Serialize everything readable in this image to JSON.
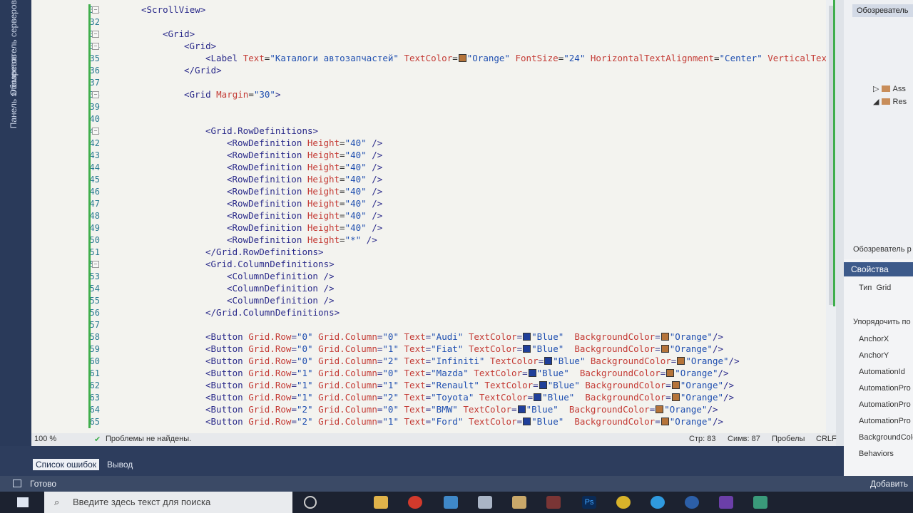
{
  "left_strip": {
    "item1": "Обозреватель серверов",
    "item2": "Панель элементов"
  },
  "lines": [
    {
      "n": "31",
      "html": "<span class=\"t\">&lt;ScrollView&gt;</span>",
      "indent": 1
    },
    {
      "n": "32",
      "html": "",
      "indent": 0
    },
    {
      "n": "33",
      "html": "<span class=\"t\">&lt;Grid&gt;</span>",
      "indent": 2
    },
    {
      "n": "34",
      "html": "<span class=\"t\">&lt;Grid&gt;</span>",
      "indent": 3
    },
    {
      "n": "35",
      "html": "<span class=\"t\">&lt;Label </span><span class=\"a\">Text</span><span class=\"p\">=</span><span class=\"v\">\"Каталоги автозапчастей\"</span> <span class=\"a\">TextColor</span><span class=\"p\">=</span>[SW:orange]<span class=\"v\">\"Orange\"</span> <span class=\"a\">FontSize</span><span class=\"p\">=</span><span class=\"v\">\"24\"</span> <span class=\"a\">HorizontalTextAlignment</span><span class=\"p\">=</span><span class=\"v\">\"Center\"</span> <span class=\"a\">VerticalTextAlignme</span>",
      "indent": 4
    },
    {
      "n": "36",
      "html": "<span class=\"t\">&lt;/Grid&gt;</span>",
      "indent": 3
    },
    {
      "n": "37",
      "html": "",
      "indent": 0
    },
    {
      "n": "38",
      "html": "<span class=\"t\">&lt;Grid </span><span class=\"a\">Margin</span><span class=\"p\">=</span><span class=\"v\">\"30\"</span><span class=\"t\">&gt;</span>",
      "indent": 3
    },
    {
      "n": "39",
      "html": "",
      "indent": 0
    },
    {
      "n": "40",
      "html": "",
      "indent": 0
    },
    {
      "n": "41",
      "html": "<span class=\"t\">&lt;Grid.RowDefinitions&gt;</span>",
      "indent": 4
    },
    {
      "n": "42",
      "html": "<span class=\"t\">&lt;RowDefinition </span><span class=\"a\">Height</span><span class=\"p\">=</span><span class=\"v\">\"40\"</span><span class=\"t\"> /&gt;</span>",
      "indent": 5
    },
    {
      "n": "43",
      "html": "<span class=\"t\">&lt;RowDefinition </span><span class=\"a\">Height</span><span class=\"p\">=</span><span class=\"v\">\"40\"</span><span class=\"t\"> /&gt;</span>",
      "indent": 5
    },
    {
      "n": "44",
      "html": "<span class=\"t\">&lt;RowDefinition </span><span class=\"a\">Height</span><span class=\"p\">=</span><span class=\"v\">\"40\"</span><span class=\"t\"> /&gt;</span>",
      "indent": 5
    },
    {
      "n": "45",
      "html": "<span class=\"t\">&lt;RowDefinition </span><span class=\"a\">Height</span><span class=\"p\">=</span><span class=\"v\">\"40\"</span><span class=\"t\"> /&gt;</span>",
      "indent": 5
    },
    {
      "n": "46",
      "html": "<span class=\"t\">&lt;RowDefinition </span><span class=\"a\">Height</span><span class=\"p\">=</span><span class=\"v\">\"40\"</span><span class=\"t\"> /&gt;</span>",
      "indent": 5
    },
    {
      "n": "47",
      "html": "<span class=\"t\">&lt;RowDefinition </span><span class=\"a\">Height</span><span class=\"p\">=</span><span class=\"v\">\"40\"</span><span class=\"t\"> /&gt;</span>",
      "indent": 5
    },
    {
      "n": "48",
      "html": "<span class=\"t\">&lt;RowDefinition </span><span class=\"a\">Height</span><span class=\"p\">=</span><span class=\"v\">\"40\"</span><span class=\"t\"> /&gt;</span>",
      "indent": 5
    },
    {
      "n": "49",
      "html": "<span class=\"t\">&lt;RowDefinition </span><span class=\"a\">Height</span><span class=\"p\">=</span><span class=\"v\">\"40\"</span><span class=\"t\"> /&gt;</span>",
      "indent": 5
    },
    {
      "n": "50",
      "html": "<span class=\"t\">&lt;RowDefinition </span><span class=\"a\">Height</span><span class=\"p\">=</span><span class=\"v\">\"*\"</span><span class=\"t\"> /&gt;</span>",
      "indent": 5
    },
    {
      "n": "51",
      "html": "<span class=\"t\">&lt;/Grid.RowDefinitions&gt;</span>",
      "indent": 4
    },
    {
      "n": "52",
      "html": "<span class=\"t\">&lt;Grid.ColumnDefinitions&gt;</span>",
      "indent": 4
    },
    {
      "n": "53",
      "html": "<span class=\"t\">&lt;ColumnDefinition /&gt;</span>",
      "indent": 5
    },
    {
      "n": "54",
      "html": "<span class=\"t\">&lt;ColumnDefinition /&gt;</span>",
      "indent": 5
    },
    {
      "n": "55",
      "html": "<span class=\"t\">&lt;ColumnDefinition /&gt;</span>",
      "indent": 5
    },
    {
      "n": "56",
      "html": "<span class=\"t\">&lt;/Grid.ColumnDefinitions&gt;</span>",
      "indent": 4
    },
    {
      "n": "57",
      "html": "",
      "indent": 0
    },
    {
      "n": "58",
      "html": "<span class=\"t\">&lt;Button </span><span class=\"a\">Grid.Row</span>=<span class=\"v\">\"0\"</span> <span class=\"a\">Grid.Column</span>=<span class=\"v\">\"0\"</span> <span class=\"a\">Text</span>=<span class=\"v\">\"Audi\"</span> <span class=\"a\">TextColor</span>=[SW:blue]<span class=\"v\">\"Blue\"</span>  <span class=\"a\">BackgroundColor</span>=[SW:orange]<span class=\"v\">\"Orange\"</span><span class=\"t\">/&gt;</span>",
      "indent": 4
    },
    {
      "n": "59",
      "html": "<span class=\"t\">&lt;Button </span><span class=\"a\">Grid.Row</span>=<span class=\"v\">\"0\"</span> <span class=\"a\">Grid.Column</span>=<span class=\"v\">\"1\"</span> <span class=\"a\">Text</span>=<span class=\"v\">\"Fiat\"</span> <span class=\"a\">TextColor</span>=[SW:blue]<span class=\"v\">\"Blue\"</span>  <span class=\"a\">BackgroundColor</span>=[SW:orange]<span class=\"v\">\"Orange\"</span><span class=\"t\">/&gt;</span>",
      "indent": 4
    },
    {
      "n": "60",
      "html": "<span class=\"t\">&lt;Button </span><span class=\"a\">Grid.Row</span>=<span class=\"v\">\"0\"</span> <span class=\"a\">Grid.Column</span>=<span class=\"v\">\"2\"</span> <span class=\"a\">Text</span>=<span class=\"v\">\"Infiniti\"</span> <span class=\"a\">TextColor</span>=[SW:blue]<span class=\"v\">\"Blue\"</span> <span class=\"a\">BackgroundColor</span>=[SW:orange]<span class=\"v\">\"Orange\"</span><span class=\"t\">/&gt;</span>",
      "indent": 4
    },
    {
      "n": "61",
      "html": "<span class=\"t\">&lt;Button </span><span class=\"a\">Grid.Row</span>=<span class=\"v\">\"1\"</span> <span class=\"a\">Grid.Column</span>=<span class=\"v\">\"0\"</span> <span class=\"a\">Text</span>=<span class=\"v\">\"Mazda\"</span> <span class=\"a\">TextColor</span>=[SW:blue]<span class=\"v\">\"Blue\"</span>  <span class=\"a\">BackgroundColor</span>=[SW:orange]<span class=\"v\">\"Orange\"</span><span class=\"t\">/&gt;</span>",
      "indent": 4
    },
    {
      "n": "62",
      "html": "<span class=\"t\">&lt;Button </span><span class=\"a\">Grid.Row</span>=<span class=\"v\">\"1\"</span> <span class=\"a\">Grid.Column</span>=<span class=\"v\">\"1\"</span> <span class=\"a\">Text</span>=<span class=\"v\">\"Renault\"</span> <span class=\"a\">TextColor</span>=[SW:blue]<span class=\"v\">\"Blue\"</span> <span class=\"a\">BackgroundColor</span>=[SW:orange]<span class=\"v\">\"Orange\"</span><span class=\"t\">/&gt;</span>",
      "indent": 4
    },
    {
      "n": "63",
      "html": "<span class=\"t\">&lt;Button </span><span class=\"a\">Grid.Row</span>=<span class=\"v\">\"1\"</span> <span class=\"a\">Grid.Column</span>=<span class=\"v\">\"2\"</span> <span class=\"a\">Text</span>=<span class=\"v\">\"Toyota\"</span> <span class=\"a\">TextColor</span>=[SW:blue]<span class=\"v\">\"Blue\"</span>  <span class=\"a\">BackgroundColor</span>=[SW:orange]<span class=\"v\">\"Orange\"</span><span class=\"t\">/&gt;</span>",
      "indent": 4
    },
    {
      "n": "64",
      "html": "<span class=\"t\">&lt;Button </span><span class=\"a\">Grid.Row</span>=<span class=\"v\">\"2\"</span> <span class=\"a\">Grid.Column</span>=<span class=\"v\">\"0\"</span> <span class=\"a\">Text</span>=<span class=\"v\">\"BMW\"</span> <span class=\"a\">TextColor</span>=[SW:blue]<span class=\"v\">\"Blue\"</span>  <span class=\"a\">BackgroundColor</span>=[SW:orange]<span class=\"v\">\"Orange\"</span><span class=\"t\">/&gt;</span>",
      "indent": 4
    },
    {
      "n": "65",
      "html": "<span class=\"t\">&lt;Button </span><span class=\"a\">Grid.Row</span>=<span class=\"v\">\"2\"</span> <span class=\"a\">Grid.Column</span>=<span class=\"v\">\"1\"</span> <span class=\"a\">Text</span>=<span class=\"v\">\"Ford\"</span> <span class=\"a\">TextColor</span>=[SW:blue]<span class=\"v\">\"Blue\"</span>  <span class=\"a\">BackgroundColor</span>=[SW:orange]<span class=\"v\">\"Orange\"</span><span class=\"t\">/&gt;</span>",
      "indent": 4
    }
  ],
  "colors": {
    "orange": "#b5743a",
    "blue": "#1f3f9a",
    "green": "#3fae4c"
  },
  "status": {
    "zoom": "100 %",
    "problems": "Проблемы не найдены.",
    "line": "Стр: 83",
    "col": "Симв: 87",
    "spaces": "Пробелы",
    "crlf": "CRLF"
  },
  "bottom_tabs": {
    "errors": "Список ошибок",
    "output": "Вывод"
  },
  "ready": "Готово",
  "add_label": "Добавить в",
  "solution": {
    "header": "Обозреватель",
    "footer": "Обозреватель р",
    "items": [
      "Ass",
      "Res"
    ]
  },
  "properties": {
    "header": "Свойства",
    "type_label": "Тип",
    "type_value": "Grid",
    "sort": "Упорядочить по",
    "items": [
      "AnchorX",
      "AnchorY",
      "AutomationId",
      "AutomationPro",
      "AutomationPro",
      "AutomationPro",
      "BackgroundColo",
      "Behaviors"
    ]
  },
  "taskbar": {
    "search_placeholder": "Введите здесь текст для поиска"
  }
}
